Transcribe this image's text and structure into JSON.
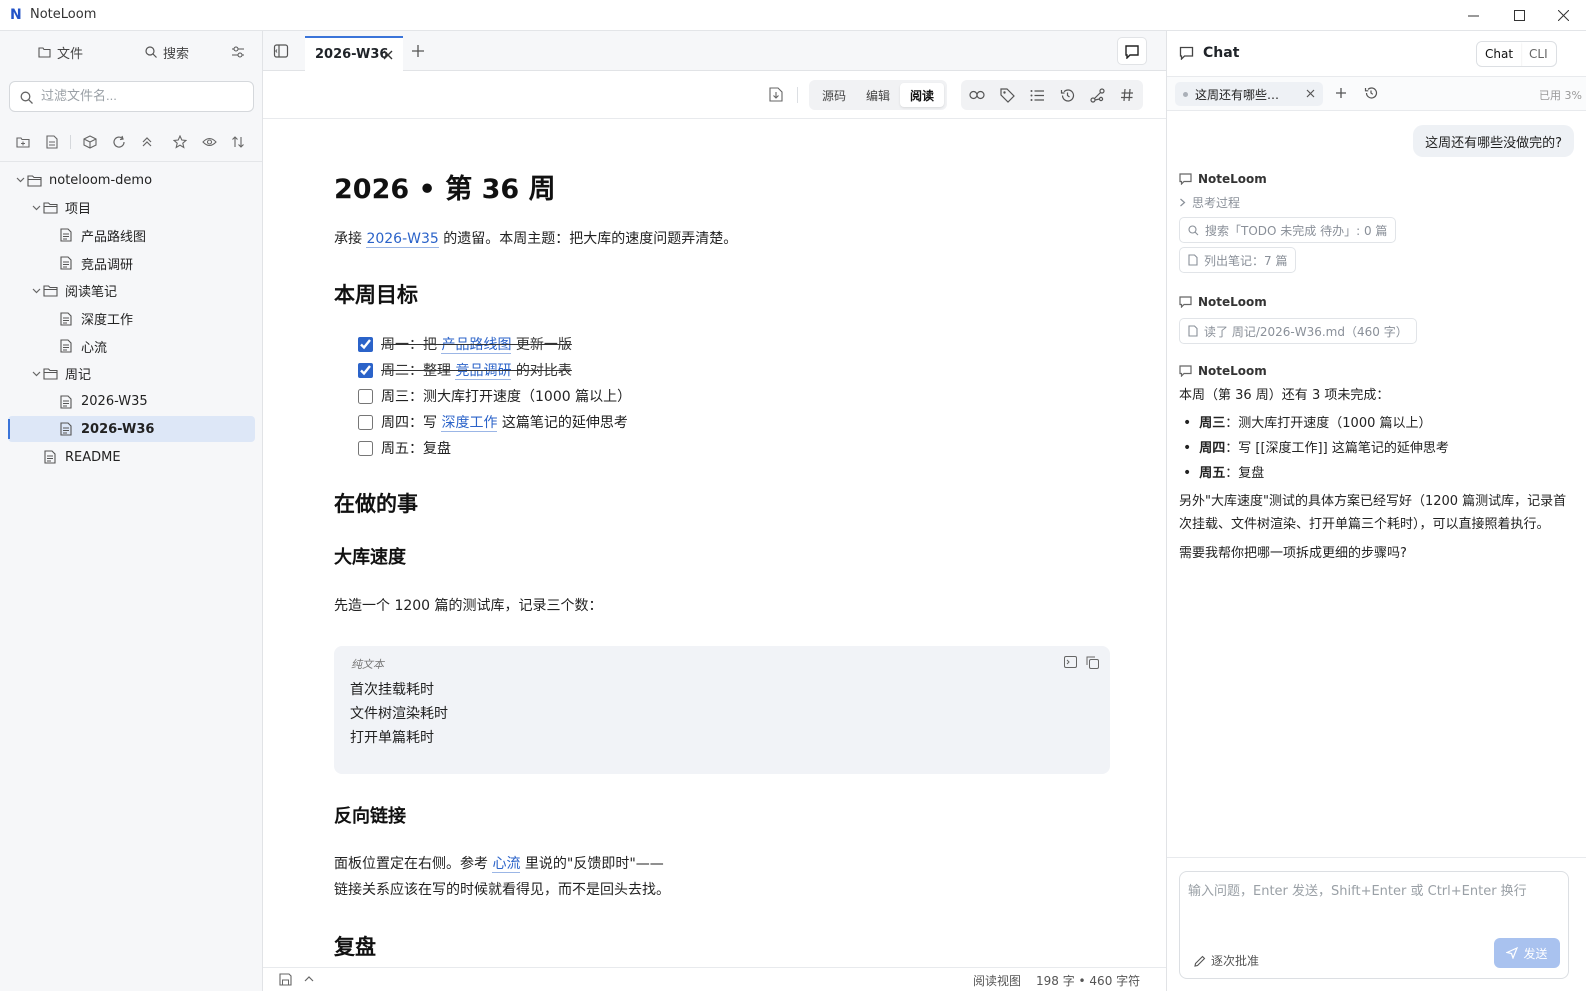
{
  "app": {
    "title": "NoteLoom",
    "logo_letter": "N"
  },
  "sidebar": {
    "tabs": [
      {
        "label": "文件"
      },
      {
        "label": "搜索"
      }
    ],
    "filter_placeholder": "过滤文件名...",
    "tree": [
      {
        "label": "noteloom-demo",
        "type": "folder"
      },
      {
        "label": "项目",
        "type": "folder"
      },
      {
        "label": "产品路线图",
        "type": "file"
      },
      {
        "label": "竞品调研",
        "type": "file"
      },
      {
        "label": "阅读笔记",
        "type": "folder"
      },
      {
        "label": "深度工作",
        "type": "file"
      },
      {
        "label": "心流",
        "type": "file"
      },
      {
        "label": "周记",
        "type": "folder"
      },
      {
        "label": "2026-W35",
        "type": "file"
      },
      {
        "label": "2026-W36",
        "type": "file",
        "active": true
      },
      {
        "label": "README",
        "type": "file"
      }
    ]
  },
  "editor": {
    "tab_label": "2026-W36",
    "modes": [
      {
        "label": "源码"
      },
      {
        "label": "编辑"
      },
      {
        "label": "阅读",
        "active": true
      }
    ],
    "doc": {
      "title": "2026 • 第 36 周",
      "intro": {
        "pre": "承接 ",
        "link": "2026-W35",
        "post": " 的遗留。本周主题：把大库的速度问题弄清楚。"
      },
      "h_goals": "本周目标",
      "tasks": [
        {
          "done": true,
          "pre": "周一：把 ",
          "link": "产品路线图",
          "post": " 更新一版"
        },
        {
          "done": true,
          "pre": "周二：整理 ",
          "link": "竞品调研",
          "post": " 的对比表"
        },
        {
          "done": false,
          "pre": "周三：测大库打开速度（1000 篇以上）",
          "link": "",
          "post": ""
        },
        {
          "done": false,
          "pre": "周四：写 ",
          "link": "深度工作",
          "post": " 这篇笔记的延伸思考"
        },
        {
          "done": false,
          "pre": "周五：复盘",
          "link": "",
          "post": ""
        }
      ],
      "h_doing": "在做的事",
      "h_speed": "大库速度",
      "speed_text": "先造一个 1200 篇的测试库，记录三个数：",
      "code_lang": "纯文本",
      "code_lines": [
        "首次挂载耗时",
        "文件树渲染耗时",
        "打开单篇耗时"
      ],
      "h_backlinks": "反向链接",
      "backlinks_pre": "面板位置定在右侧。参考 ",
      "backlinks_link": "心流",
      "backlinks_post": " 里说的\"反馈即时\"——",
      "backlinks_line2": "链接关系应该在写的时候就看得见，而不是回头去找。",
      "h_review": "复盘"
    },
    "status": {
      "view": "阅读视图",
      "counts": "198 字 • 460 字符"
    }
  },
  "chat": {
    "title": "Chat",
    "segments": [
      {
        "label": "Chat",
        "active": true
      },
      {
        "label": "CLI"
      }
    ],
    "conversation_tab": "这周还有哪些…",
    "usage": "已用 3%",
    "user_message": "这周还有哪些没做完的?",
    "assistant_name": "NoteLoom",
    "thinking_label": "思考过程",
    "tool_search": "搜索「TODO 未完成 待办」: 0 篇",
    "tool_list": "列出笔记：7 篇",
    "tool_read": "读了 周记/2026-W36.md（460 字）",
    "answer_intro": "本周（第 36 周）还有 3 项未完成：",
    "answer_items": [
      {
        "bold": "周三",
        "text": "：测大库打开速度（1000 篇以上）"
      },
      {
        "bold": "周四",
        "text": "：写 [[深度工作]] 这篇笔记的延伸思考"
      },
      {
        "bold": "周五",
        "text": "：复盘"
      }
    ],
    "answer_para1": "另外\"大库速度\"测试的具体方案已经写好（1200 篇测试库，记录首次挂载、文件树渲染、打开单篇三个耗时），可以直接照着执行。",
    "answer_para2": "需要我帮你把哪一项拆成更细的步骤吗?",
    "input_placeholder": "输入问题，Enter 发送，Shift+Enter 或 Ctrl+Enter 换行",
    "approve_label": "逐次批准",
    "send_label": "发送"
  },
  "colors": {
    "accent": "#2b63c9",
    "selection": "#dde7f7",
    "send_disabled": "#a9c2ef"
  }
}
